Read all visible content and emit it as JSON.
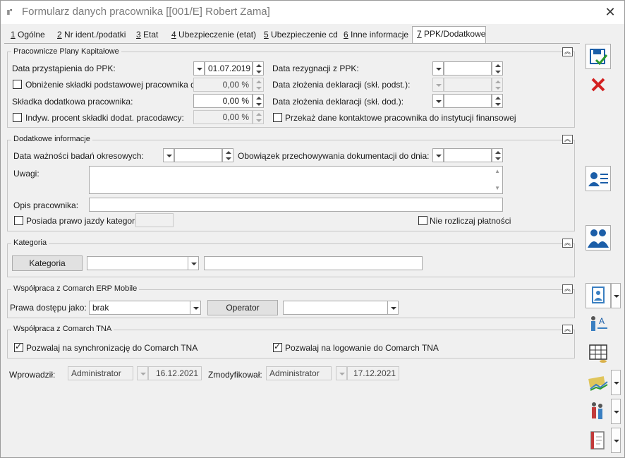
{
  "window": {
    "title": "Formularz danych pracownika [[001/E] Robert Zama]"
  },
  "tabs": [
    {
      "num": "1",
      "label": "Ogólne"
    },
    {
      "num": "2",
      "label": "Nr ident./podatki"
    },
    {
      "num": "3",
      "label": "Etat"
    },
    {
      "num": "4",
      "label": "Ubezpieczenie (etat)"
    },
    {
      "num": "5",
      "label": "Ubezpieczenie cd"
    },
    {
      "num": "6",
      "label": "Inne informacje"
    },
    {
      "num": "7",
      "label": "PPK/Dodatkowe"
    }
  ],
  "ppk": {
    "title": "Pracownicze Plany Kapitałowe",
    "join_label": "Data przystąpienia do PPK:",
    "join_value": "01.07.2019",
    "reduce_label": "Obniżenie składki podstawowej pracownika do:",
    "reduce_value": "0,00 %",
    "extra_label": "Składka dodatkowa pracownika:",
    "extra_value": "0,00 %",
    "indiv_label": "Indyw. procent składki dodat. pracodawcy:",
    "indiv_value": "0,00 %",
    "resign_label": "Data rezygnacji z PPK:",
    "decl_basic_label": "Data złożenia deklaracji (skł. podst.):",
    "decl_extra_label": "Data złożenia deklaracji (skł. dod.):",
    "transfer_label": "Przekaż dane kontaktowe pracownika do instytucji finansowej"
  },
  "extra": {
    "title": "Dodatkowe informacje",
    "exam_label": "Data ważności badań okresowych:",
    "doc_label": "Obowiązek przechowywania dokumentacji do dnia:",
    "notes_label": "Uwagi:",
    "desc_label": "Opis pracownika:",
    "license_label": "Posiada prawo jazdy kategorii:",
    "no_settle_label": "Nie rozliczaj płatności"
  },
  "category": {
    "title": "Kategoria",
    "button": "Kategoria"
  },
  "mobile": {
    "title": "Współpraca z Comarch ERP Mobile",
    "access_label": "Prawa dostępu jako:",
    "access_value": "brak",
    "operator_button": "Operator"
  },
  "tna": {
    "title": "Współpraca z Comarch TNA",
    "sync_label": "Pozwalaj na synchronizację do Comarch TNA",
    "login_label": "Pozwalaj na logowanie do Comarch TNA"
  },
  "footer": {
    "entered_label": "Wprowadził:",
    "entered_by": "Administrator",
    "entered_date": "16.12.2021",
    "modified_label": "Zmodyfikował:",
    "modified_by": "Administrator",
    "modified_date": "17.12.2021"
  },
  "colors": {
    "accent": "#1b5ea8",
    "cancel": "#d32020"
  }
}
